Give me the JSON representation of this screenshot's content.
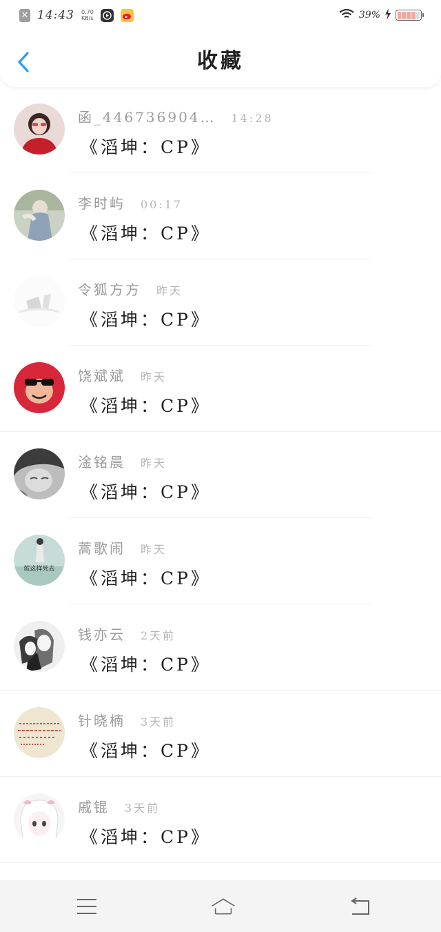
{
  "status_bar": {
    "time": "14:43",
    "speed_value": "0.70",
    "speed_unit": "KB/s",
    "battery": "39%",
    "icons": [
      "close-x-icon",
      "video-play-icon",
      "weibo-icon",
      "wifi-icon",
      "charging-icon",
      "battery-icon"
    ]
  },
  "header": {
    "title": "收藏",
    "back_icon": "chevron-left-icon"
  },
  "items": [
    {
      "name": "函_446736904…",
      "time": "14:28",
      "message": "《滔坤：CP》",
      "avatar": "girl-red-dress"
    },
    {
      "name": "李时屿",
      "time": "00:17",
      "message": "《滔坤：CP》",
      "avatar": "person-jeans"
    },
    {
      "name": "令狐方方",
      "time": "昨天",
      "message": "《滔坤：CP》",
      "avatar": "white-abstract"
    },
    {
      "name": "饶斌斌",
      "time": "昨天",
      "message": "《滔坤：CP》",
      "avatar": "red-monkey-sunglasses"
    },
    {
      "name": "淦铭晨",
      "time": "昨天",
      "message": "《滔坤：CP》",
      "avatar": "bw-portrait"
    },
    {
      "name": "蒿歌闹",
      "time": "昨天",
      "message": "《滔坤：CP》",
      "avatar": "seaside-girl",
      "avatar_text": "就这样死去"
    },
    {
      "name": "钱亦云",
      "time": "2天前",
      "message": "《滔坤：CP》",
      "avatar": "anime-couple"
    },
    {
      "name": "针晓楠",
      "time": "3天前",
      "message": "《滔坤：CP》",
      "avatar": "handwriting-note"
    },
    {
      "name": "戚锟",
      "time": "3天前",
      "message": "《滔坤：CP》",
      "avatar": "anime-girl-pink"
    }
  ],
  "nav": {
    "menu_icon": "menu-icon",
    "home_icon": "home-icon",
    "back_icon": "back-return-icon"
  },
  "colors": {
    "accent": "#2b9cf2",
    "name": "#9a9a9a",
    "message": "#222222",
    "navbar_bg": "#f4f4f4"
  }
}
